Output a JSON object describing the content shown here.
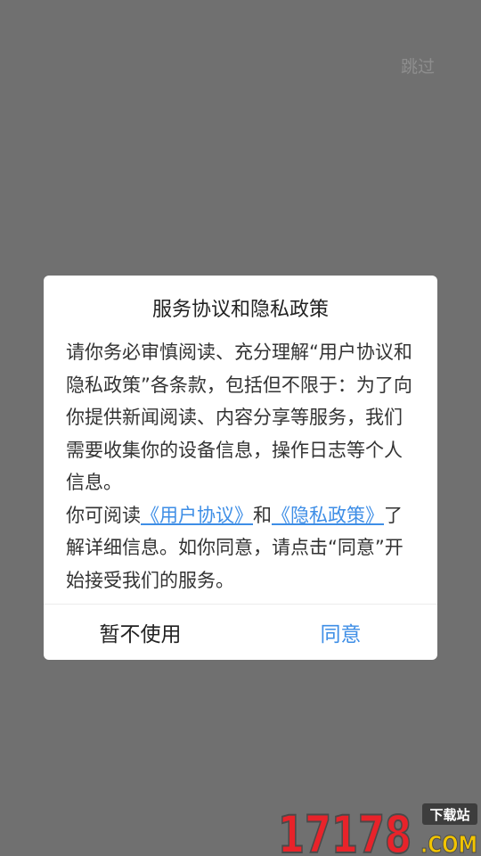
{
  "skip": {
    "label": "跳过"
  },
  "dialog": {
    "title": "服务协议和隐私政策",
    "paragraph1": "请你务必审慎阅读、充分理解“用户协议和隐私政策”各条款，包括但不限于：为了向你提供新闻阅读、内容分享等服务，我们需要收集你的设备信息，操作日志等个人信息。",
    "p2_prefix": "你可阅读",
    "p2_link_user_agreement": "《用户协议》",
    "p2_and": "和",
    "p2_link_privacy_policy": "《隐私政策》",
    "p2_suffix": "了解详细信息。如你同意，请点击“同意”开始接受我们的服务。",
    "decline_label": "暂不使用",
    "agree_label": "同意"
  },
  "watermark": {
    "number": "17178",
    "tag": "下载站",
    "domain": ".COM"
  },
  "colors": {
    "overlay": "#707070",
    "accent_blue": "#3e8ee6",
    "watermark_red": "#e8232a"
  }
}
